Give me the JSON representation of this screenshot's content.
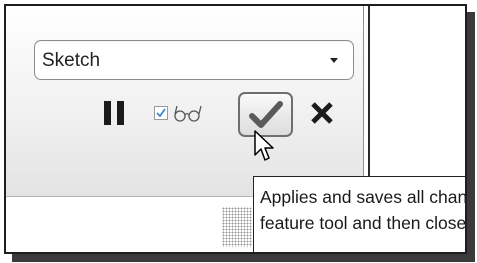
{
  "toolbar": {
    "feature_type_select": {
      "selected": "Sketch"
    },
    "icons": {
      "pause": "pause-icon",
      "preview_checkbox": "checkbox-icon",
      "preview": "glasses-icon",
      "apply": "checkmark-icon",
      "cancel": "close-icon"
    },
    "preview_checked": true
  },
  "tooltip": {
    "line1": "Applies and saves all changes made in the",
    "line2": "feature tool and then closes the tool."
  },
  "colors": {
    "panel_top": "#ffffff",
    "panel_bottom": "#e3e3e3",
    "checkmark": "#5a5a5a",
    "dark_icon": "#1b1b1b",
    "check_accent": "#2f7fd0"
  }
}
